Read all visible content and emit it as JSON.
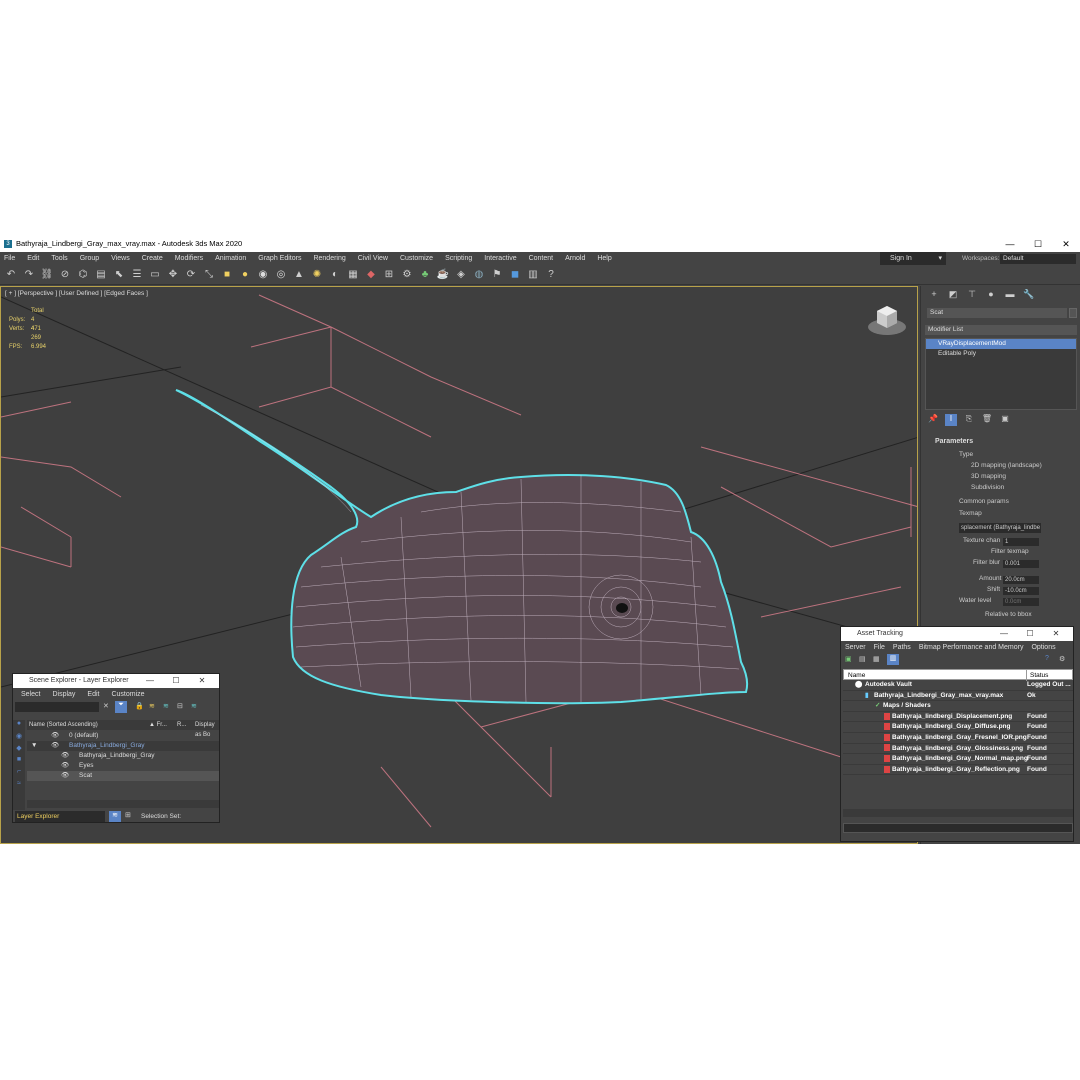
{
  "window": {
    "title": "Bathyraja_Lindbergi_Gray_max_vray.max - Autodesk 3ds Max 2020",
    "min": "—",
    "max": "☐",
    "close": "✕"
  },
  "menu": [
    "File",
    "Edit",
    "Tools",
    "Group",
    "Views",
    "Create",
    "Modifiers",
    "Animation",
    "Graph Editors",
    "Rendering",
    "Civil View",
    "Customize",
    "Scripting",
    "Interactive",
    "Content",
    "Arnold",
    "Help"
  ],
  "signin": {
    "label": "Sign In"
  },
  "workspaces": {
    "label": "Workspaces:",
    "value": "Default"
  },
  "viewport": {
    "label": "[ + ] [Perspective ] [User Defined ] [Edged Faces ]",
    "stats": {
      "total_label": "Total",
      "polys_label": "Polys:",
      "polys": "4 471",
      "verts_label": "Verts:",
      "verts": "4 269",
      "fps_label": "FPS:",
      "fps": "6.994"
    }
  },
  "command_panel": {
    "object_name": "Scat",
    "modifier_list": "Modifier List",
    "stack": [
      "VRayDisplacementMod",
      "Editable Poly"
    ],
    "parameters": {
      "title": "Parameters",
      "type_label": "Type",
      "types": [
        "2D mapping (landscape)",
        "3D mapping",
        "Subdivision"
      ],
      "common_label": "Common params",
      "texmap_label": "Texmap",
      "texmap_value": "splacement (Bathyraja_lindbe",
      "texture_chan_label": "Texture chan",
      "texture_chan": "1",
      "filter_texmap": "Filter texmap",
      "filter_blur_label": "Filter blur",
      "filter_blur": "0.001",
      "amount_label": "Amount",
      "amount": "20.0cm",
      "shift_label": "Shift",
      "shift": "-10.0cm",
      "water_label": "Water level",
      "water": "0.0cm",
      "relative": "Relative to bbox"
    }
  },
  "scene_explorer": {
    "title": "Scene Explorer - Layer Explorer",
    "menu": [
      "Select",
      "Display",
      "Edit",
      "Customize"
    ],
    "columns": [
      "Name (Sorted Ascending)",
      "▲ Fr...",
      "R...",
      "Display as Bo"
    ],
    "rows": [
      "0 (default)",
      "Bathyraja_Lindbergi_Gray",
      "Bathyraja_Lindbergi_Gray",
      "Eyes",
      "Scat"
    ],
    "footer_mode": "Layer Explorer",
    "selection_set": "Selection Set:"
  },
  "asset_tracking": {
    "title": "Asset Tracking",
    "menu": [
      "Server",
      "File",
      "Paths",
      "Bitmap Performance and Memory",
      "Options"
    ],
    "col_name": "Name",
    "col_status": "Status",
    "rows": [
      {
        "name": "Autodesk Vault",
        "status": "Logged Out ..."
      },
      {
        "name": "Bathyraja_Lindbergi_Gray_max_vray.max",
        "status": "Ok"
      },
      {
        "name": "Maps / Shaders",
        "status": ""
      },
      {
        "name": "Bathyraja_lindbergi_Displacement.png",
        "status": "Found"
      },
      {
        "name": "Bathyraja_lindbergi_Gray_Diffuse.png",
        "status": "Found"
      },
      {
        "name": "Bathyraja_lindbergi_Gray_Fresnel_IOR.png",
        "status": "Found"
      },
      {
        "name": "Bathyraja_lindbergi_Gray_Glossiness.png",
        "status": "Found"
      },
      {
        "name": "Bathyraja_lindbergi_Gray_Normal_map.png",
        "status": "Found"
      },
      {
        "name": "Bathyraja_lindbergi_Gray_Reflection.png",
        "status": "Found"
      }
    ]
  },
  "colors": {
    "accent": "#5a84c6",
    "viewport_border": "#b8a24a",
    "wire": "#e8d8e8",
    "selection": "#5ee0e8",
    "grid": "#d47c8a"
  }
}
